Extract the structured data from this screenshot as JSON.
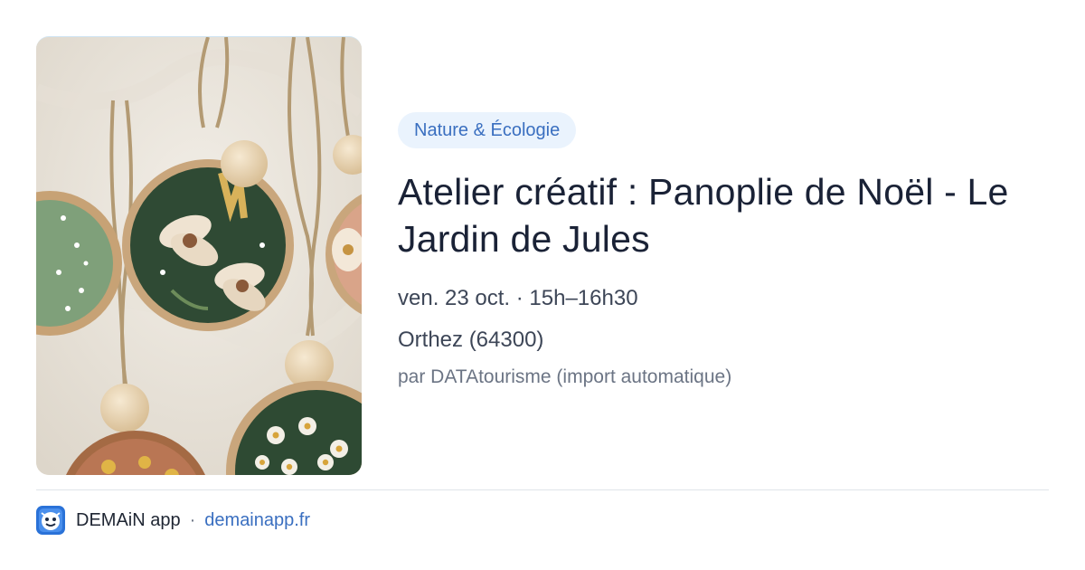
{
  "event": {
    "category": "Nature & Écologie",
    "title": "Atelier créatif : Panoplie de Noël - Le Jardin de Jules",
    "datetime": "ven. 23 oct. · 15h–16h30",
    "location": "Orthez (64300)",
    "source": "par DATAtourisme (import automatique)",
    "image_icon": "painted-wood-ornaments-photo"
  },
  "footer": {
    "app_name": "DEMAiN app",
    "separator": "·",
    "site": "demainapp.fr",
    "app_icon": "demain-app-icon"
  },
  "colors": {
    "accent": "#3a6fc0",
    "badge_bg": "#eaf3fd",
    "title": "#1a2236",
    "muted": "#6b7484"
  }
}
